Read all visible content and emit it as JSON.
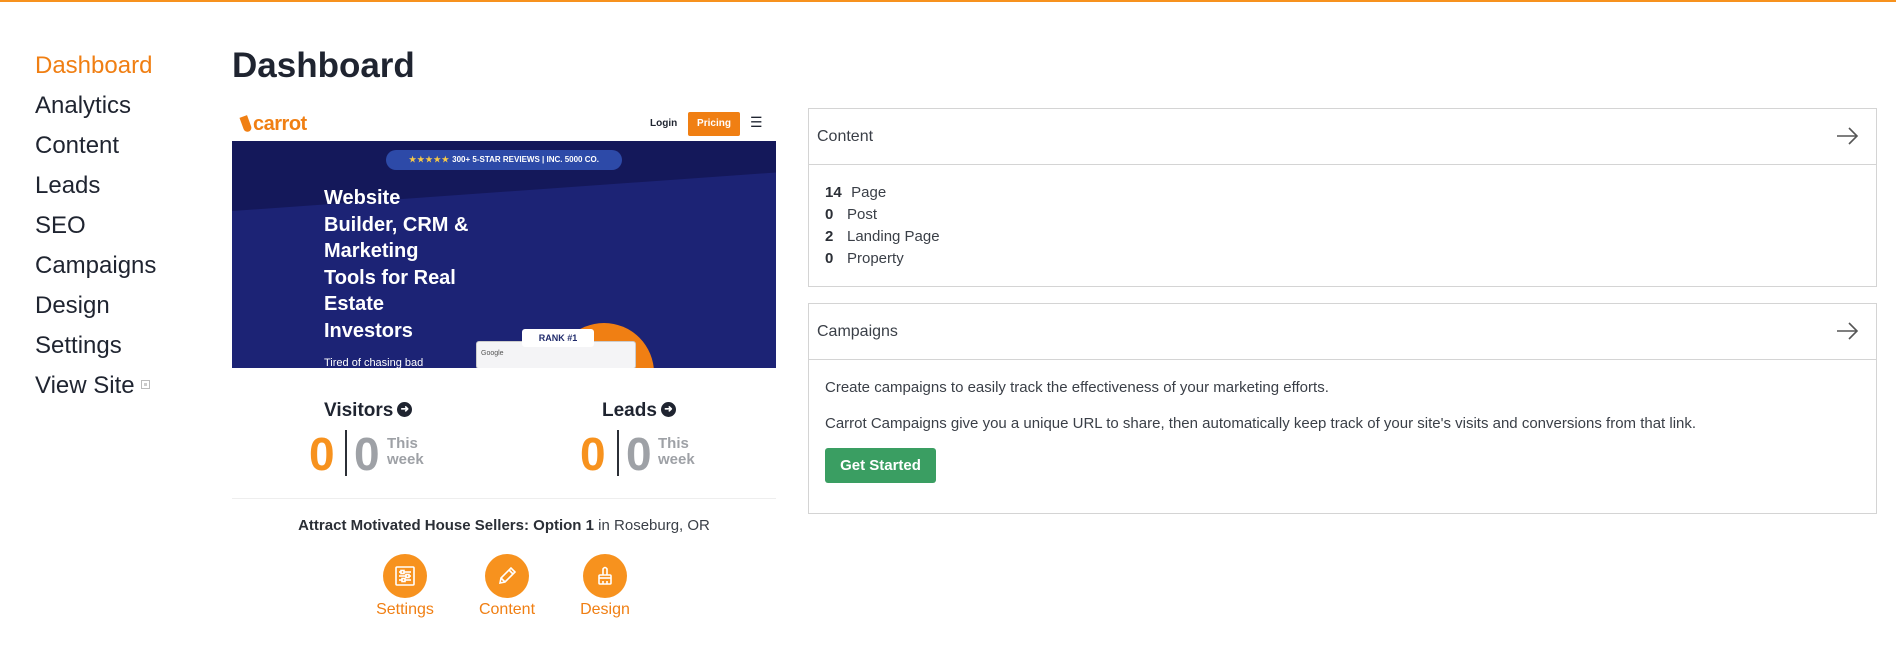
{
  "sidebar": {
    "items": [
      {
        "label": "Dashboard"
      },
      {
        "label": "Analytics"
      },
      {
        "label": "Content"
      },
      {
        "label": "Leads"
      },
      {
        "label": "SEO"
      },
      {
        "label": "Campaigns"
      },
      {
        "label": "Design"
      },
      {
        "label": "Settings"
      },
      {
        "label": "View Site"
      }
    ],
    "active": "Dashboard"
  },
  "page": {
    "title": "Dashboard"
  },
  "preview": {
    "logo": "carrot",
    "login": "Login",
    "pricing": "Pricing",
    "menu_icon": "☰",
    "badge_stars": "★★★★★",
    "badge_text": "300+ 5-STAR REVIEWS | INC. 5000 CO.",
    "headline": "Website Builder, CRM & Marketing Tools for Real Estate Investors",
    "sub": "Tired of chasing bad",
    "rank": "RANK #1",
    "search_brand": "Google"
  },
  "stats": {
    "visitors": {
      "label": "Visitors",
      "total": "0",
      "week": "0",
      "week_label": "This week"
    },
    "leads": {
      "label": "Leads",
      "total": "0",
      "week": "0",
      "week_label": "This week"
    }
  },
  "campaign": {
    "name": "Attract Motivated House Sellers: Option 1",
    "in": "in",
    "location": "Roseburg, OR"
  },
  "actions": [
    {
      "label": "Settings",
      "icon": "settings-sliders-icon"
    },
    {
      "label": "Content",
      "icon": "pencil-icon"
    },
    {
      "label": "Design",
      "icon": "paintbrush-icon"
    }
  ],
  "content_card": {
    "title": "Content",
    "rows": [
      {
        "count": "14",
        "label": "Page"
      },
      {
        "count": "0",
        "label": "Post"
      },
      {
        "count": "2",
        "label": "Landing Page"
      },
      {
        "count": "0",
        "label": "Property"
      }
    ]
  },
  "campaigns_card": {
    "title": "Campaigns",
    "line1": "Create campaigns to easily track the effectiveness of your marketing efforts.",
    "line2": "Carrot Campaigns give you a unique URL to share, then automatically keep track of your site's visits and conversions from that link.",
    "button": "Get Started"
  },
  "colors": {
    "accent": "#f07f13",
    "success": "#3a9e62",
    "hero": "#1c2375"
  }
}
